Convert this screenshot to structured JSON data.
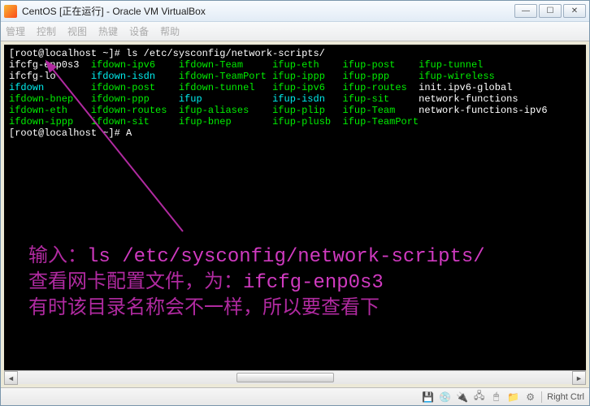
{
  "titlebar": {
    "title": "CentOS [正在运行] - Oracle VM VirtualBox"
  },
  "menu": [
    "管理",
    "控制",
    "视图",
    "热键",
    "设备",
    "帮助"
  ],
  "terminal": {
    "prompt1": "[root@localhost ~]# ",
    "cmd1": "ls /etc/sysconfig/network-scripts/",
    "rows": [
      [
        "ifcfg-enp0s3",
        "ifdown-ipv6",
        "ifdown-Team",
        "ifup-eth",
        "ifup-post",
        "ifup-tunnel"
      ],
      [
        "ifcfg-lo",
        "ifdown-isdn",
        "ifdown-TeamPort",
        "ifup-ippp",
        "ifup-ppp",
        "ifup-wireless"
      ],
      [
        "ifdown",
        "ifdown-post",
        "ifdown-tunnel",
        "ifup-ipv6",
        "ifup-routes",
        "init.ipv6-global"
      ],
      [
        "ifdown-bnep",
        "ifdown-ppp",
        "ifup",
        "ifup-isdn",
        "ifup-sit",
        "network-functions"
      ],
      [
        "ifdown-eth",
        "ifdown-routes",
        "ifup-aliases",
        "ifup-plip",
        "ifup-Team",
        "network-functions-ipv6"
      ],
      [
        "ifdown-ippp",
        "ifdown-sit",
        "ifup-bnep",
        "ifup-plusb",
        "ifup-TeamPort",
        ""
      ]
    ],
    "cyan_files": [
      "ifdown",
      "ifdown-isdn",
      "ifup",
      "ifup-isdn"
    ],
    "white_files": [
      "ifcfg-enp0s3",
      "ifcfg-lo",
      "init.ipv6-global",
      "network-functions",
      "network-functions-ipv6"
    ],
    "prompt2": "[root@localhost ~]# A"
  },
  "annotation": {
    "line1_label": "输入：",
    "line1_cmd": "ls /etc/sysconfig/network-scripts/",
    "line2a": "查看网卡配置文件，为：",
    "line2b": "ifcfg-enp0s3",
    "line3": "有时该目录名称会不一样，所以要查看下"
  },
  "statusbar": {
    "icons": [
      "💾",
      "💿",
      "🔌",
      "🖧",
      "🖱",
      "📁",
      "⚙"
    ],
    "hostkey": "Right Ctrl"
  },
  "winbtns": {
    "min": "—",
    "max": "☐",
    "close": "✕"
  },
  "cols": [
    0,
    14,
    29,
    45,
    57,
    70
  ]
}
